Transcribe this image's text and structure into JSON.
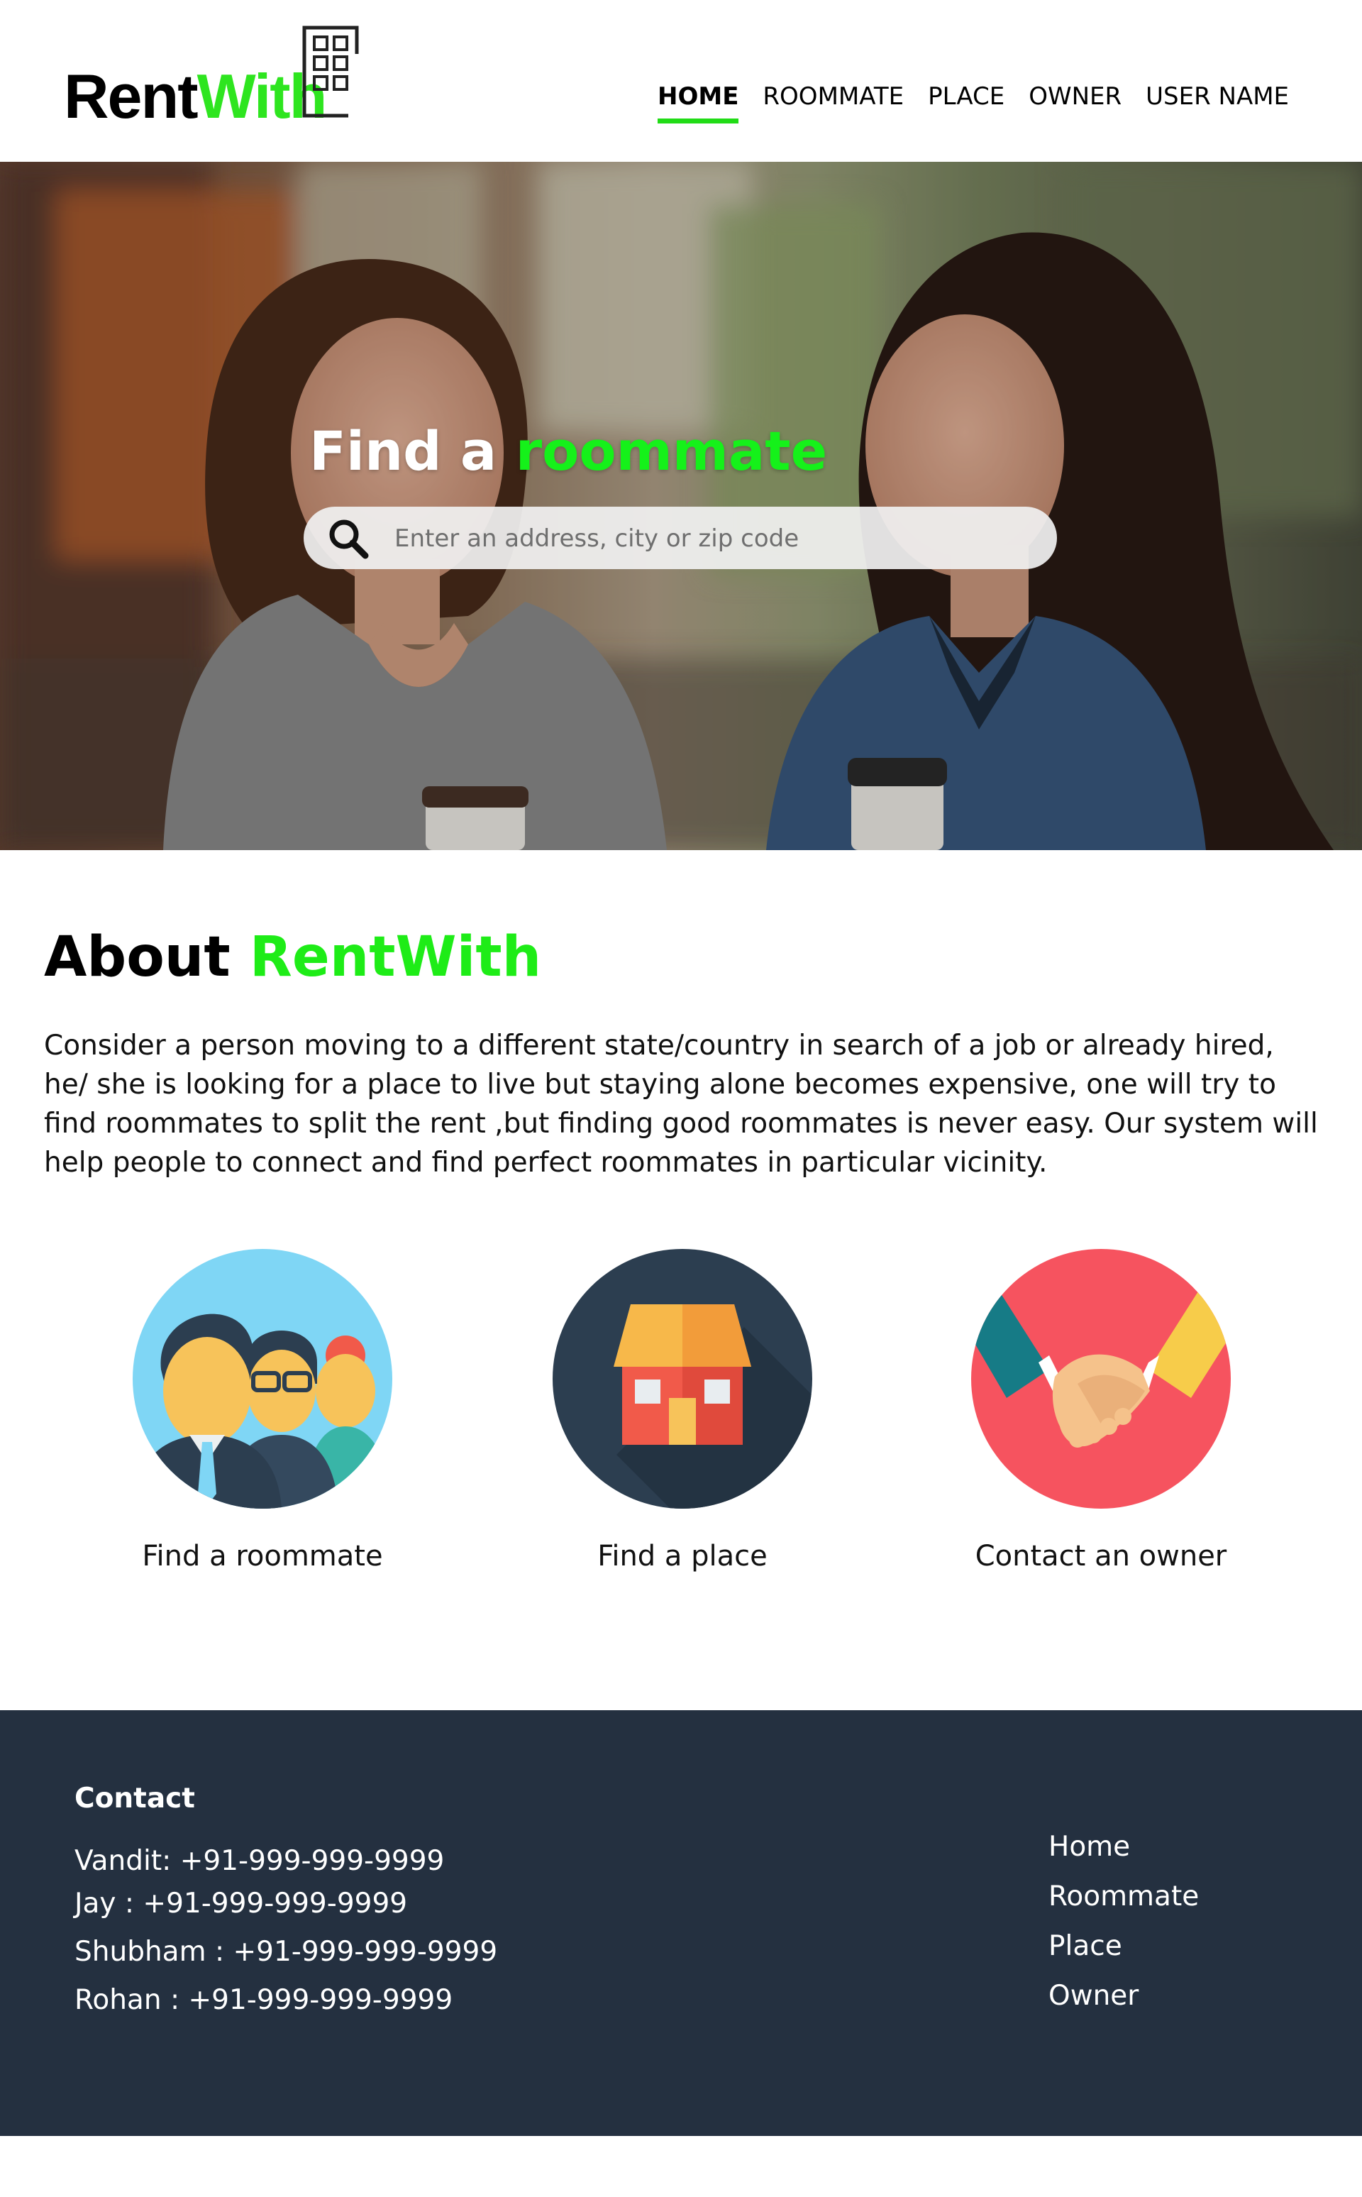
{
  "brand": {
    "name_part1": "Rent",
    "name_part2": "With",
    "accent_color": "#2ee51f"
  },
  "nav": {
    "items": [
      {
        "label": "HOME",
        "active": true
      },
      {
        "label": "ROOMMATE",
        "active": false
      },
      {
        "label": "PLACE",
        "active": false
      },
      {
        "label": "OWNER",
        "active": false
      },
      {
        "label": "USER NAME",
        "active": false
      }
    ]
  },
  "hero": {
    "title_part1": "Find a",
    "title_part2": "roommate",
    "search_placeholder": "Enter an address, city or zip code",
    "search_icon": "search-icon"
  },
  "about": {
    "title_part1": "About",
    "title_part2": "RentWith",
    "text": "Consider a person moving to a different state/country in search of a job or already hired, he/ she is looking for a place to live but staying alone becomes expensive, one will try to find roommates to split the rent ,but finding good roommates is never easy. Our system will help people to connect and find perfect roommates in particular vicinity."
  },
  "features": [
    {
      "label": "Find a roommate",
      "icon": "people-group-icon",
      "color": "#7fd6f5"
    },
    {
      "label": "Find a place",
      "icon": "house-icon",
      "color": "#2c3e50"
    },
    {
      "label": "Contact an owner",
      "icon": "handshake-icon",
      "color": "#f6535f"
    }
  ],
  "footer": {
    "contact_title": "Contact",
    "contacts": [
      "Vandit: +91-999-999-9999",
      "Jay : +91-999-999-9999",
      "Shubham : +91-999-999-9999",
      "Rohan : +91-999-999-9999"
    ],
    "links": [
      "Home",
      "Roommate",
      "Place",
      "Owner"
    ],
    "background_color": "#243040"
  }
}
